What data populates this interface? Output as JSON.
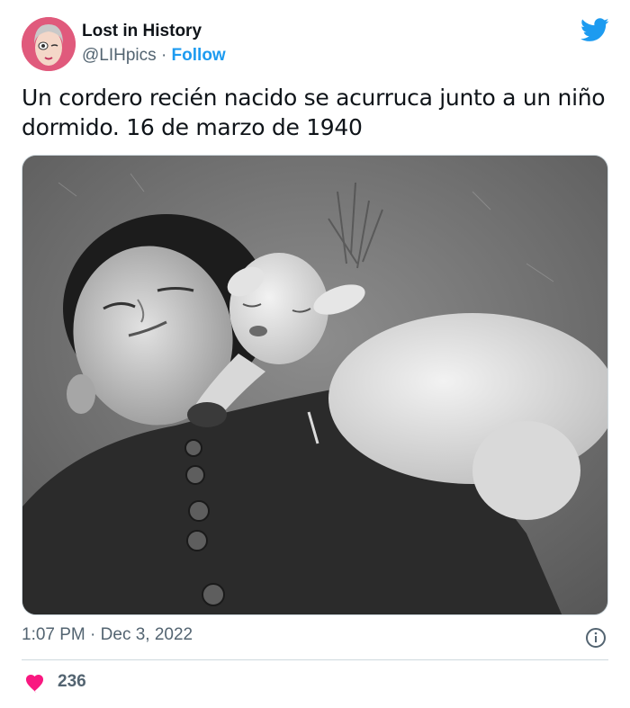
{
  "author": {
    "display_name": "Lost in History",
    "handle": "@LIHpics",
    "separator": "·",
    "follow_label": "Follow",
    "avatar_icon": "avatar-illustrated-face"
  },
  "brand": {
    "icon": "twitter-bird-icon",
    "color": "#1d9bf0"
  },
  "tweet": {
    "text": "Un cordero recién nacido se acurruca junto a un niño dormido. 16 de marzo de 1940",
    "photo_alt": "black-and-white photo of a sleeping boy with a newborn lamb"
  },
  "meta": {
    "time": "1:07 PM",
    "separator": "·",
    "date": "Dec 3, 2022",
    "info_icon": "info-icon"
  },
  "engagement": {
    "like_icon": "heart-icon",
    "like_color": "#f91880",
    "like_count": "236"
  }
}
